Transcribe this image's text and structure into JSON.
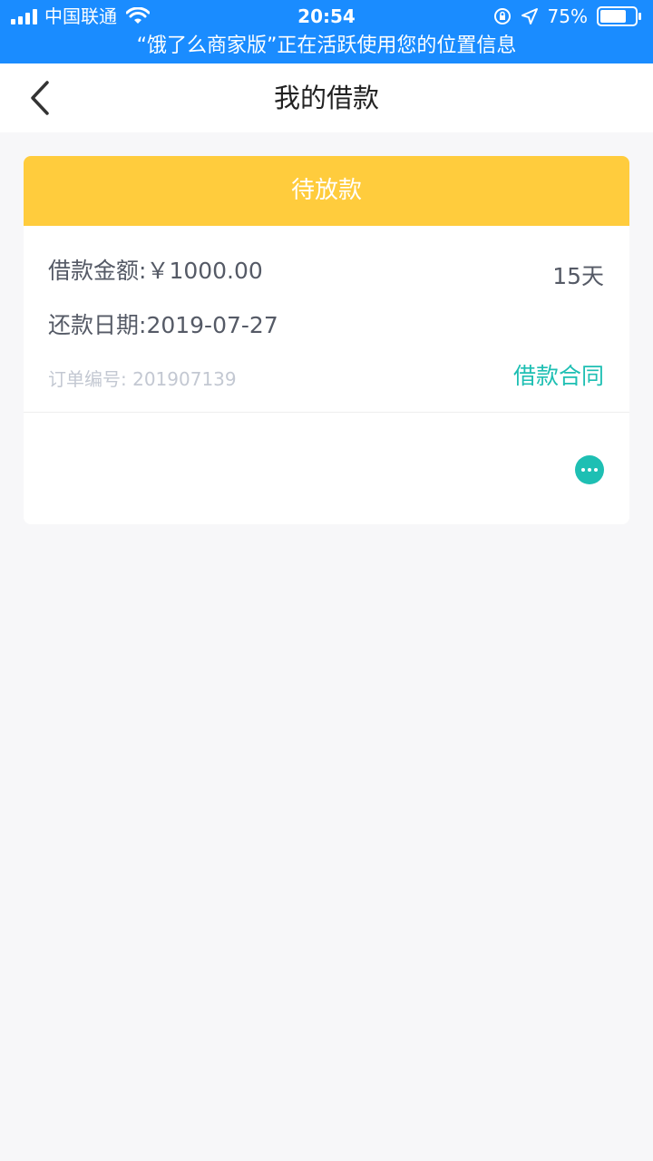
{
  "status_bar": {
    "carrier": "中国联通",
    "time": "20:54",
    "battery": "75%",
    "banner": "“饿了么商家版”正在活跃使用您的位置信息"
  },
  "nav": {
    "title": "我的借款",
    "back_icon": "chevron-left-icon"
  },
  "loan": {
    "status": "待放款",
    "amount_label": "借款金额:",
    "amount_value": "￥1000.00",
    "term": "15天",
    "repay_label": "还款日期:",
    "repay_date": "2019-07-27",
    "order_label": "订单编号:",
    "order_number": "201907139",
    "contract_label": "借款合同"
  },
  "colors": {
    "status_bar": "#1a8cff",
    "card_header": "#ffcc3d",
    "accent_teal": "#1ebfb3",
    "page_bg": "#f7f7f9"
  }
}
